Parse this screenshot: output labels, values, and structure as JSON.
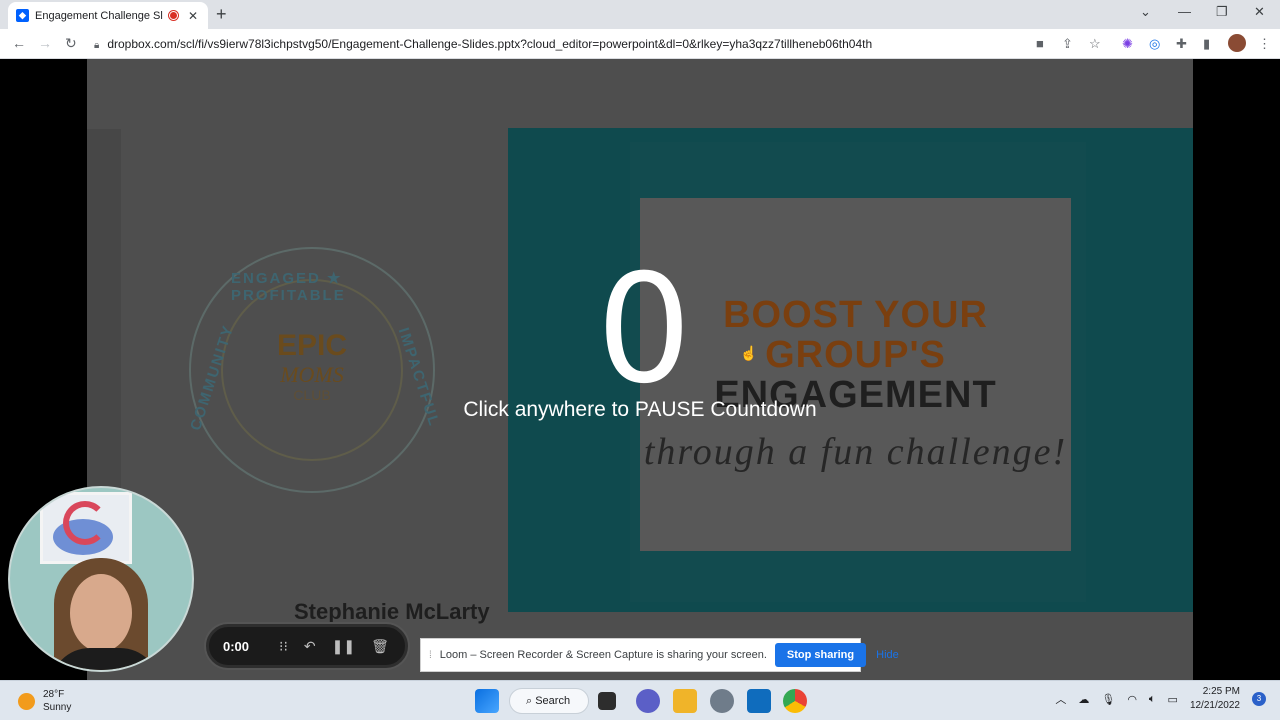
{
  "browser": {
    "tab_title": "Engagement Challenge Slides",
    "tab_close": "✕",
    "new_tab": "+",
    "url": "dropbox.com/scl/fi/vs9ierw78l3ichpstvg50/Engagement-Challenge-Slides.pptx?cloud_editor=powerpoint&dl=0&rlkey=yha3qzz7tillheneb06th04th"
  },
  "slide": {
    "logo": {
      "ring_top": "ENGAGED ★ PROFITABLE",
      "ring_left": "COMMUNITY",
      "ring_right": "IMPACTFUL",
      "epic": "EPIC",
      "moms": "MOMS",
      "club": "CLUB"
    },
    "headline_line1": "BOOST YOUR",
    "headline_line2": "GROUP'S",
    "headline_line3": "ENGAGEMENT",
    "script_text": "through a fun challenge!",
    "presenter_name": "Stephanie McLarty"
  },
  "countdown": {
    "value": "0",
    "message": "Click anywhere to PAUSE Countdown"
  },
  "loom": {
    "timer": "0:00",
    "share_message": "Loom – Screen Recorder & Screen Capture is sharing your screen.",
    "stop_label": "Stop sharing",
    "hide_label": "Hide"
  },
  "taskbar": {
    "temperature": "28°F",
    "condition": "Sunny",
    "search_label": "Search",
    "time": "2:25 PM",
    "date": "12/21/2022",
    "notification_count": "3"
  },
  "colors": {
    "teal": "#0f4a4e",
    "headline_orange": "#8a4a12",
    "accent_blue": "#1a73e8"
  }
}
